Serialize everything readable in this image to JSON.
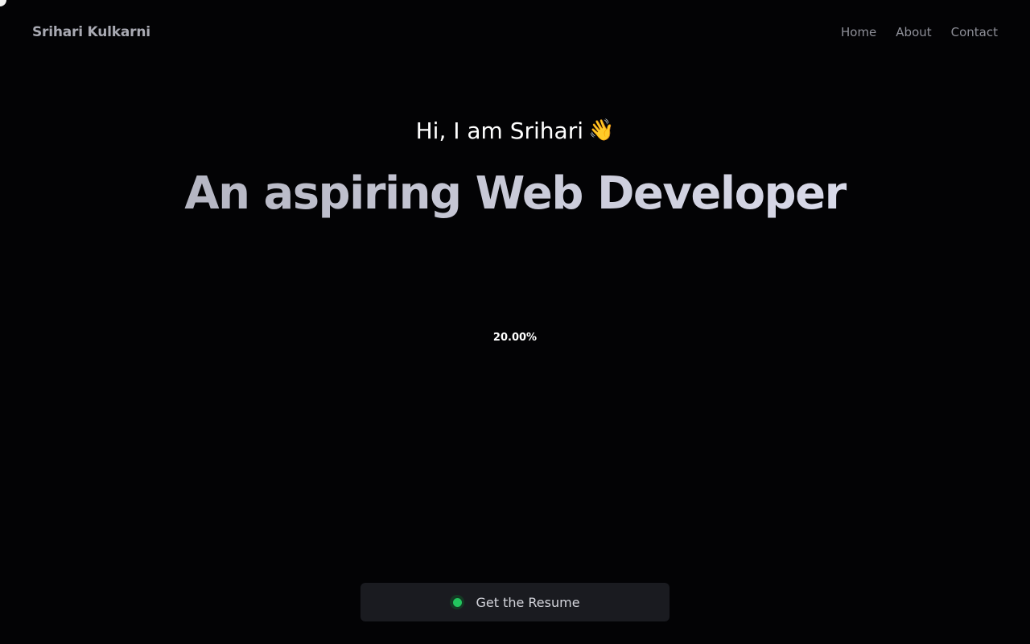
{
  "navbar": {
    "brand": "Srihari Kulkarni",
    "links": [
      {
        "label": "Home"
      },
      {
        "label": "About"
      },
      {
        "label": "Contact"
      }
    ]
  },
  "hero": {
    "greeting": "Hi, I am Srihari",
    "wave_emoji": "👋",
    "headline": "An aspiring Web Developer"
  },
  "loader": {
    "progress_text": "20.00%",
    "progress_value": 0.2
  },
  "cta": {
    "label": "Get the Resume",
    "status_color": "#22c55e"
  },
  "colors": {
    "background": "#030305",
    "accent_green": "#22c55e"
  }
}
